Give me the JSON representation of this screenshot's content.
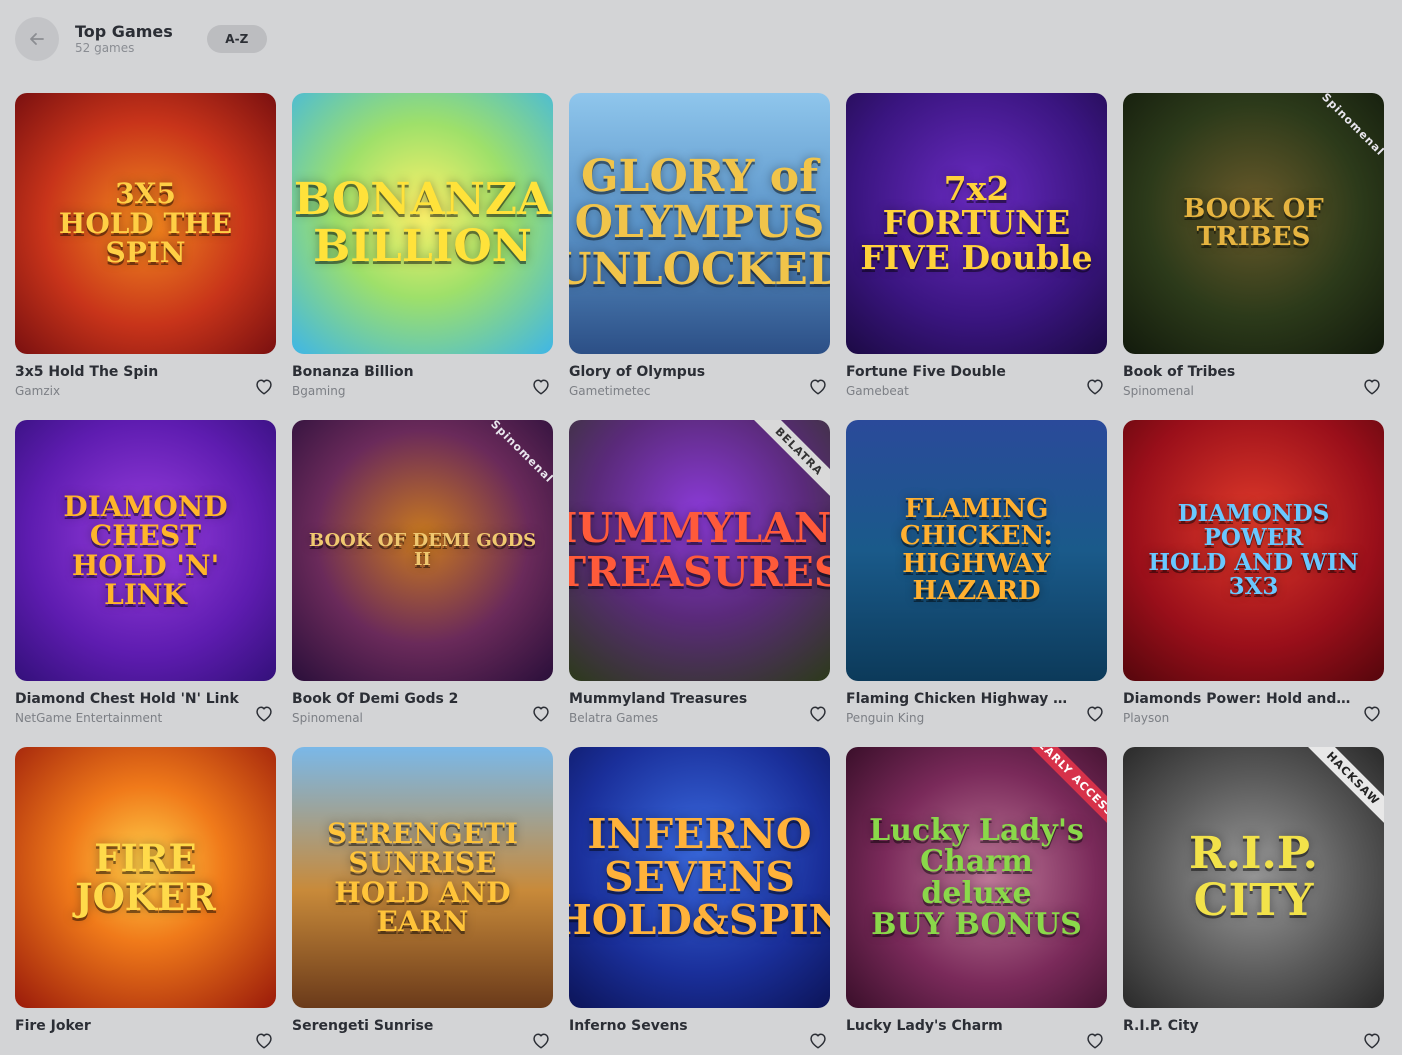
{
  "header": {
    "title": "Top Games",
    "subtitle": "52 games",
    "sort_label": "A-Z"
  },
  "games": [
    {
      "title": "3x5 Hold The Spin",
      "provider": "Gamzix",
      "art": "3X5\nHOLD THE SPIN",
      "bg": "radial-gradient(circle at 50% 50%, #f28a1e 0%, #c8341a 55%, #7a1010 100%)",
      "fg": "#ffcf45"
    },
    {
      "title": "Bonanza Billion",
      "provider": "Bgaming",
      "art": "BONANZA\nBILLION",
      "bg": "radial-gradient(circle at 50% 45%, #fff26a 0%, #9ee06a 45%, #3fb6e6 100%)",
      "fg": "#ffe23a"
    },
    {
      "title": "Glory of Olympus",
      "provider": "Gametimetec",
      "art": "GLORY of\nOLYMPUS\nUNLOCKED",
      "bg": "linear-gradient(180deg, #8fc6ec 0%, #5a93c8 50%, #2c4f86 100%)",
      "fg": "#f1c44a"
    },
    {
      "title": "Fortune Five Double",
      "provider": "Gamebeat",
      "art": "7x2\nFORTUNE\nFIVE Double",
      "bg": "radial-gradient(circle at 50% 40%, #6a2bc2 0%, #3a1580 60%, #1c0a44 100%)",
      "fg": "#ffd23a"
    },
    {
      "title": "Book of Tribes",
      "provider": "Spinomenal",
      "art": "BOOK OF TRIBES",
      "bg": "radial-gradient(circle at 50% 45%, #6a5a2a 0%, #2c3a1a 55%, #121a0c 100%)",
      "fg": "#e6b440",
      "ribbon": "Spinomenal",
      "ribbon_bg": "transparent",
      "ribbon_fg": "#e9e6ee"
    },
    {
      "title": "Diamond Chest Hold 'N' Link",
      "provider": "NetGame Entertainment",
      "art": "DIAMOND\nCHEST\nHOLD 'N' LINK",
      "bg": "radial-gradient(circle at 50% 45%, #9a3fe0 0%, #5e1cb0 60%, #33107a 100%)",
      "fg": "#ffb52a"
    },
    {
      "title": "Book Of Demi Gods 2",
      "provider": "Spinomenal",
      "art": "BOOK OF DEMI GODS II",
      "bg": "radial-gradient(circle at 50% 45%, #c97a1e 0%, #6a2a5a 55%, #2a0f3a 100%)",
      "fg": "#f0c870",
      "ribbon": "Spinomenal",
      "ribbon_bg": "transparent",
      "ribbon_fg": "#e9e6ee"
    },
    {
      "title": "Mummyland Treasures",
      "provider": "Belatra Games",
      "art": "MUMMYLAND\nTREASURES",
      "bg": "radial-gradient(circle at 50% 35%, #8a3ad6 0%, #5a2a7a 50%, #2c3a1a 100%)",
      "fg": "#ff5a3a",
      "ribbon": "BELATRA",
      "ribbon_bg": "#d9d9d9",
      "ribbon_fg": "#333333"
    },
    {
      "title": "Flaming Chicken Highway Hazard",
      "provider": "Penguin King",
      "art": "FLAMING\nCHICKEN:\nHIGHWAY HAZARD",
      "bg": "linear-gradient(180deg, #2a4a9a 0%, #1a5a8a 50%, #0c3a5a 100%)",
      "fg": "#ffb030"
    },
    {
      "title": "Diamonds Power: Hold and Win",
      "provider": "Playson",
      "art": "DIAMONDS\nPOWER\nHOLD AND WIN 3X3",
      "bg": "radial-gradient(circle at 50% 40%, #e03a2a 0%, #9a0f1a 60%, #55060c 100%)",
      "fg": "#6ac8ff"
    },
    {
      "title": "Fire Joker",
      "provider": "",
      "art": "FIRE JOKER",
      "bg": "radial-gradient(circle at 50% 45%, #ffcf4a 0%, #f07a1a 40%, #9a1a0a 100%)",
      "fg": "#ffda4a"
    },
    {
      "title": "Serengeti Sunrise",
      "provider": "",
      "art": "SERENGETI\nSUNRISE\nHOLD AND EARN",
      "bg": "linear-gradient(180deg, #7ab8e8 0%, #c88a3a 55%, #6a3a1a 100%)",
      "fg": "#ffc43a"
    },
    {
      "title": "Inferno Sevens",
      "provider": "",
      "art": "INFERNO\nSEVENS\nHOLD&SPIN",
      "bg": "radial-gradient(circle at 50% 40%, #3a6ae0 0%, #1a2f9a 60%, #0c1458 100%)",
      "fg": "#ffb23a"
    },
    {
      "title": "Lucky Lady's Charm",
      "provider": "",
      "art": "Lucky Lady's\nCharm deluxe\nBUY BONUS",
      "bg": "radial-gradient(circle at 55% 50%, #c07a9a 0%, #7a2a5a 55%, #3a0f2a 100%)",
      "fg": "#8ad84a",
      "ribbon": "EARLY ACCESS",
      "ribbon_bg": "#d6324a",
      "ribbon_fg": "#ffffff"
    },
    {
      "title": "R.I.P. City",
      "provider": "",
      "art": "R.I.P.\nCITY",
      "bg": "radial-gradient(circle at 50% 50%, #9a9a9a 0%, #5a5a5a 55%, #2a2a2a 100%)",
      "fg": "#f2e24a",
      "ribbon": "HACKSAW",
      "ribbon_bg": "#e8e8e8",
      "ribbon_fg": "#222222"
    }
  ],
  "colors": {
    "background": "#d3d4d6",
    "text_primary": "#2b2e35",
    "text_secondary": "#7c7f85"
  },
  "icons": {
    "back": "arrow-left-icon",
    "favorite": "heart-outline-icon"
  }
}
